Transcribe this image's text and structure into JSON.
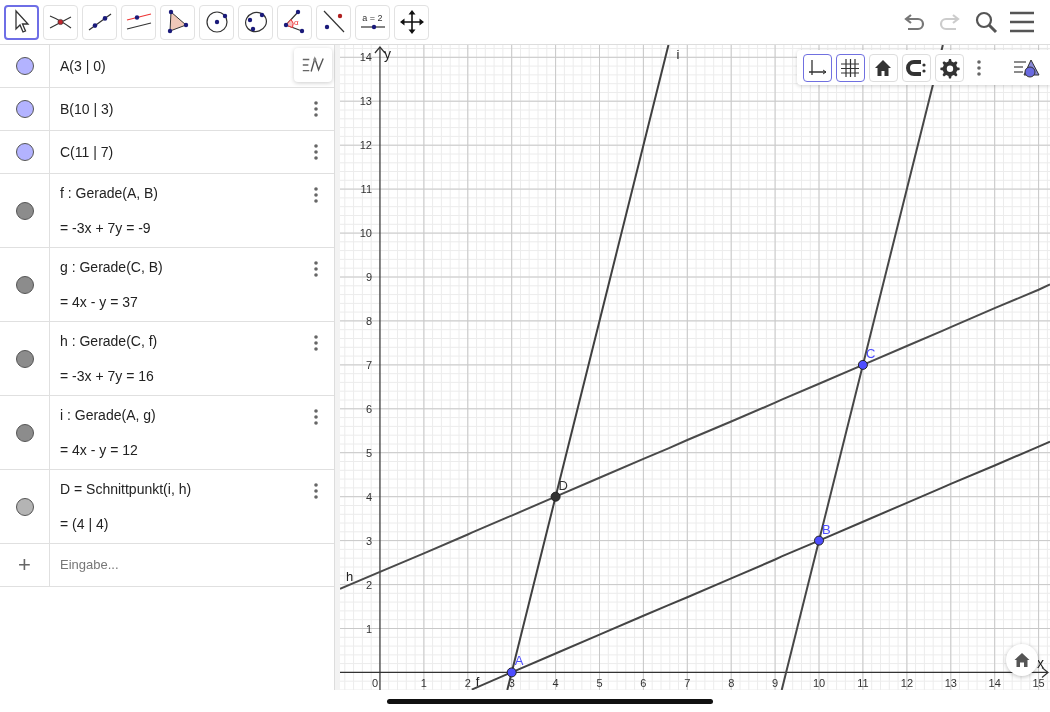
{
  "toolbar": {
    "tools": [
      {
        "kind": "move",
        "selected": true
      },
      {
        "kind": "intersect",
        "selected": false
      },
      {
        "kind": "line",
        "selected": false
      },
      {
        "kind": "parallel",
        "selected": false
      },
      {
        "kind": "polygon",
        "selected": false
      },
      {
        "kind": "circle-center",
        "selected": false
      },
      {
        "kind": "circle-three",
        "selected": false
      },
      {
        "kind": "angle",
        "selected": false,
        "text": "α"
      },
      {
        "kind": "reflect",
        "selected": false
      },
      {
        "kind": "slider",
        "selected": false,
        "text": "a = 2"
      },
      {
        "kind": "move-view",
        "selected": false
      }
    ],
    "undo": {
      "disabled": false
    },
    "redo": {
      "disabled": true
    }
  },
  "algebra": {
    "items": [
      {
        "definition": "A(3 | 0)",
        "color": "#b3b3ff",
        "menu": false
      },
      {
        "definition": "B(10 | 3)",
        "color": "#b3b3ff",
        "menu": true
      },
      {
        "definition": "C(11 | 7)",
        "color": "#b3b3ff",
        "menu": true
      },
      {
        "definition": "f : Gerade(A, B)",
        "value": "=  -3x + 7y = -9",
        "color": "#8c8c8c",
        "menu": true
      },
      {
        "definition": "g : Gerade(C, B)",
        "value": "=  4x - y = 37",
        "color": "#8c8c8c",
        "menu": true
      },
      {
        "definition": "h : Gerade(C, f)",
        "value": "=  -3x + 7y = 16",
        "color": "#8c8c8c",
        "menu": true
      },
      {
        "definition": "i : Gerade(A, g)",
        "value": "=  4x - y = 12",
        "color": "#8c8c8c",
        "menu": true
      },
      {
        "definition": "D  =  Schnittpunkt(i, h)",
        "value": "=  (4 | 4)",
        "color": "#b4b4b4",
        "menu": true
      }
    ],
    "input": {
      "icon": "+",
      "placeholder": "Eingabe..."
    }
  },
  "graphics": {
    "style_bar": [
      {
        "kind": "axes",
        "selected": true
      },
      {
        "kind": "grid",
        "selected": true
      },
      {
        "kind": "home",
        "selected": false
      },
      {
        "kind": "magnet",
        "selected": false
      },
      {
        "kind": "gear",
        "selected": false
      }
    ],
    "chart_data": {
      "type": "line",
      "xlabel": "x",
      "ylabel": "y",
      "xlim": [
        -0.91,
        15.26
      ],
      "ylim": [
        -0.4,
        14.28
      ],
      "xticks": [
        {
          "value": 0,
          "label": "0"
        },
        1,
        2,
        3,
        4,
        5,
        6,
        7,
        8,
        9,
        10,
        11,
        12,
        13,
        14,
        15
      ],
      "yticks": [
        1,
        2,
        3,
        4,
        5,
        6,
        7,
        8,
        9,
        10,
        11,
        12,
        13,
        14
      ],
      "x": [
        -0.91,
        0,
        1,
        2,
        2.09,
        2.9,
        3,
        4,
        5,
        6,
        6.57,
        7,
        8,
        9,
        9.15,
        10,
        11,
        12,
        12.82,
        13,
        14,
        15,
        15.26
      ],
      "grid": true,
      "series": [
        {
          "name": "f",
          "color": "#444444",
          "values": [
            null,
            null,
            null,
            null,
            -0.39,
            -0.04,
            0,
            0.43,
            0.86,
            1.29,
            1.53,
            1.71,
            2.14,
            2.57,
            2.64,
            3,
            3.43,
            3.86,
            4.21,
            4.29,
            4.71,
            5.14,
            5.25
          ]
        },
        {
          "color": "#474747",
          "values": [
            null,
            null,
            null,
            null,
            null,
            null,
            null,
            null,
            null,
            null,
            null,
            null,
            null,
            null,
            -0.4,
            3,
            7,
            11,
            14.28,
            null,
            null,
            null,
            null
          ]
        },
        {
          "name": "h",
          "color": "#4a4a4a",
          "values": [
            1.9,
            2.29,
            2.71,
            3.14,
            3.18,
            3.53,
            3.57,
            4,
            4.43,
            4.86,
            5.1,
            5.29,
            5.71,
            6.14,
            6.21,
            6.57,
            7,
            7.43,
            7.78,
            7.86,
            8.29,
            8.71,
            8.83
          ]
        },
        {
          "name": "i",
          "color": "#404040",
          "values": [
            null,
            null,
            null,
            null,
            null,
            -0.4,
            0,
            4,
            8,
            12,
            14.28,
            null,
            null,
            null,
            null,
            null,
            null,
            null,
            null,
            null,
            null,
            null,
            null
          ]
        },
        {
          "name": "A",
          "color": "#4d4dff",
          "marker": "circle",
          "values": [
            null,
            null,
            null,
            null,
            null,
            null,
            0,
            null,
            null,
            null,
            null,
            null,
            null,
            null,
            null,
            null,
            null,
            null,
            null,
            null,
            null,
            null,
            null
          ]
        },
        {
          "name": "B",
          "color": "#4d4dff",
          "marker": "circle",
          "values": [
            null,
            null,
            null,
            null,
            null,
            null,
            null,
            null,
            null,
            null,
            null,
            null,
            null,
            null,
            null,
            3,
            null,
            null,
            null,
            null,
            null,
            null,
            null
          ]
        },
        {
          "name": "C",
          "color": "#4d4dff",
          "marker": "circle",
          "values": [
            null,
            null,
            null,
            null,
            null,
            null,
            null,
            null,
            null,
            null,
            null,
            null,
            null,
            null,
            null,
            null,
            7,
            null,
            null,
            null,
            null,
            null,
            null
          ]
        },
        {
          "name": "D",
          "color": "#333333",
          "marker": "circle",
          "values": [
            null,
            null,
            null,
            null,
            null,
            null,
            null,
            4,
            null,
            null,
            null,
            null,
            null,
            null,
            null,
            null,
            null,
            null,
            null,
            null,
            null,
            null,
            null
          ]
        }
      ]
    }
  }
}
